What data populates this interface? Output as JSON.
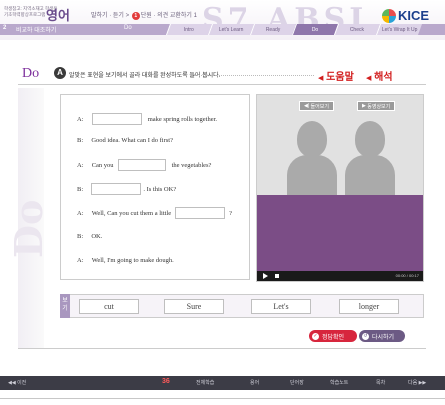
{
  "header": {
    "small_line1": "학생참고: 지역소재고 학생용",
    "small_line2": "기초학력향상프로그램",
    "subject": "영어",
    "crumb_prefix": "말하기 · 듣기 >",
    "unit_num": "1",
    "crumb_suffix": "단원 · 의견 교환하기 1",
    "deco_letters": "S7 ABSI",
    "logo_text": "KICE"
  },
  "nav": {
    "number": "2",
    "title": "비교하 대조하기",
    "section": "Do",
    "tabs": [
      "Intro",
      "Let's Learn",
      "Ready",
      "Do",
      "Check",
      "Let's Wrap It Up"
    ],
    "active_tab": "Do"
  },
  "main": {
    "title": "Do",
    "badge": "A",
    "instruction": "알맞은 표현을 보기에서 골라 대화를 완성하도록 들어 봅시다.",
    "help_label": "도움말",
    "explain_label": "해석"
  },
  "dialogue": [
    {
      "speaker": "A",
      "before": "",
      "after": "make spring rolls together."
    },
    {
      "speaker": "B",
      "text": "Good idea. What can I do first?"
    },
    {
      "speaker": "A",
      "before": "Can you",
      "after": "the vegetables?"
    },
    {
      "speaker": "B",
      "before": "",
      "after": ". Is this OK?"
    },
    {
      "speaker": "A",
      "before": "Well, Can you cut them a little",
      "after": "?"
    },
    {
      "speaker": "B",
      "text": "OK."
    },
    {
      "speaker": "A",
      "text": "Well, I'm going to make dough."
    }
  ],
  "video": {
    "listen_label": "들어보기",
    "watch_label": "동영상보기",
    "time": "00:00 / 00:17"
  },
  "wordbox": {
    "label": "보기",
    "words": [
      "cut",
      "Sure",
      "Let's",
      "longer"
    ]
  },
  "actions": {
    "check_label": "정답확인",
    "retry_label": "다시하기"
  },
  "footer": {
    "prev": "◀◀ 이전",
    "page": "36",
    "items": [
      "전체학습",
      "용어",
      "단어장",
      "학습노트",
      "목차"
    ],
    "next": "다음 ▶▶"
  },
  "colors": {
    "accent": "#7d2f9c",
    "nav_bar": "#b9a8cc",
    "video_purple": "#7b4d86",
    "check_button": "#d7263d",
    "retry_button": "#6c5a84"
  }
}
